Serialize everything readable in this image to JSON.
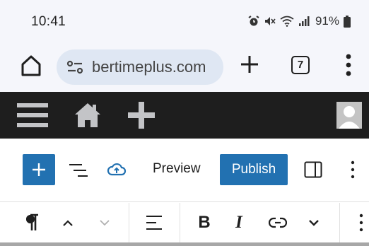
{
  "status_bar": {
    "time": "10:41",
    "battery": "91%",
    "icons": [
      "alarm-icon",
      "mute-icon",
      "wifi-icon",
      "signal-icon",
      "battery-icon"
    ]
  },
  "browser": {
    "url": "bertimeplus.com",
    "tab_count": "7",
    "icons": [
      "home-icon",
      "site-info-icon",
      "new-tab-icon",
      "tab-switcher-icon",
      "overflow-menu-icon"
    ]
  },
  "admin_bar": {
    "icons": [
      "hamburger-icon",
      "site-home-icon",
      "plus-icon",
      "avatar-icon"
    ],
    "colors": {
      "background": "#1e1e1e"
    }
  },
  "editor_toolbar": {
    "preview_label": "Preview",
    "publish_label": "Publish",
    "icons": [
      "plus-icon",
      "list-view-icon",
      "cloud-upload-icon",
      "sidebar-icon",
      "overflow-menu-icon"
    ],
    "colors": {
      "accent": "#2271b1"
    }
  },
  "block_toolbar": {
    "bold_label": "B",
    "italic_label": "I",
    "icons": [
      "paragraph-icon",
      "chevron-up-icon",
      "chevron-down-icon",
      "align-icon",
      "link-icon",
      "more-formatting-icon",
      "overflow-menu-icon"
    ]
  }
}
